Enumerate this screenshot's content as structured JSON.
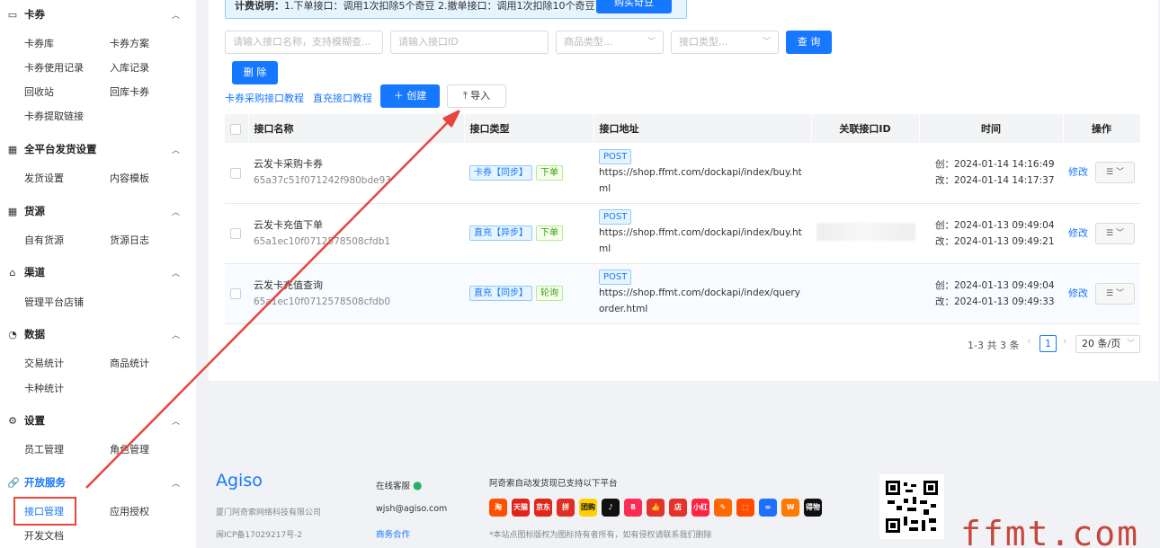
{
  "sidebar": {
    "sections": [
      {
        "title": "卡券",
        "icon": "card-icon",
        "items": [
          "卡券库",
          "卡券方案",
          "卡券使用记录",
          "入库记录",
          "回收站",
          "回库卡券",
          "卡券提取链接"
        ]
      },
      {
        "title": "全平台发货设置",
        "icon": "grid-icon",
        "items": [
          "发货设置",
          "内容模板"
        ]
      },
      {
        "title": "货源",
        "icon": "grid-icon",
        "items": [
          "自有货源",
          "货源日志"
        ]
      },
      {
        "title": "渠道",
        "icon": "store-icon",
        "items": [
          "管理平台店铺"
        ]
      },
      {
        "title": "数据",
        "icon": "pie-icon",
        "items": [
          "交易统计",
          "商品统计",
          "卡种统计"
        ]
      },
      {
        "title": "设置",
        "icon": "gear-icon",
        "items": [
          "员工管理",
          "角色管理"
        ]
      },
      {
        "title": "开放服务",
        "icon": "link-icon",
        "items": [
          "接口管理",
          "应用授权",
          "开发文档"
        ]
      }
    ]
  },
  "notice": {
    "label": "计费说明：",
    "text": "1.下单接口：调用1次扣除5个奇豆  2.撤单接口：调用1次扣除10个奇豆",
    "button": "购买奇豆"
  },
  "filters": {
    "name_placeholder": "请输入接口名称，支持模糊查...",
    "id_placeholder": "请输入接口ID",
    "goods_type": "商品类型...",
    "api_type": "接口类型...",
    "query": "查 询",
    "delete": "删 除"
  },
  "toolbar": {
    "tutorial1": "卡券采购接口教程",
    "tutorial2": "直充接口教程",
    "create": "创建",
    "import": "导入"
  },
  "table": {
    "headers": [
      "接口名称",
      "接口类型",
      "接口地址",
      "关联接口ID",
      "时间",
      "操作"
    ],
    "rows": [
      {
        "name": "云发卡采购卡券",
        "id": "65a37c51f071242f980bde93",
        "type_tag": "卡券【同步】",
        "type_tag2": "下单",
        "method": "POST",
        "url": "https://shop.ffmt.com/dockapi/index/buy.html",
        "created": "创：2024-01-14 14:16:49",
        "modified": "改：2024-01-14 14:17:37",
        "edit": "修改"
      },
      {
        "name": "云发卡充值下单",
        "id": "65a1ec10f0712578508cfdb1",
        "type_tag": "直充【异步】",
        "type_tag2": "下单",
        "method": "POST",
        "url": "https://shop.ffmt.com/dockapi/index/buy.html",
        "created": "创：2024-01-13 09:49:04",
        "modified": "改：2024-01-13 09:49:21",
        "edit": "修改"
      },
      {
        "name": "云发卡充值查询",
        "id": "65a1ec10f0712578508cfdb0",
        "type_tag": "直充【同步】",
        "type_tag2": "轮询",
        "method": "POST",
        "url": "https://shop.ffmt.com/dockapi/index/queryorder.html",
        "created": "创：2024-01-13 09:49:04",
        "modified": "改：2024-01-13 09:49:33",
        "edit": "修改"
      }
    ]
  },
  "pagination": {
    "total": "1-3 共 3 条",
    "page": "1",
    "page_size": "20 条/页"
  },
  "footer": {
    "brand": "Agiso",
    "company": "厦门阿奇索网络科技有限公司",
    "icp": "闽ICP备17029217号-2",
    "online_service": "在线客服",
    "email": "wjsh@agiso.com",
    "business": "商务合作",
    "platforms_title": "阿奇索自动发货现已支持以下平台",
    "platforms": [
      {
        "label": "淘",
        "color": "#ff5000"
      },
      {
        "label": "天猫",
        "color": "#e2231a"
      },
      {
        "label": "京东",
        "color": "#e1251b"
      },
      {
        "label": "拼",
        "color": "#e02e24"
      },
      {
        "label": "团购",
        "color": "#ffd100"
      },
      {
        "label": "♪",
        "color": "#111111"
      },
      {
        "label": "8",
        "color": "#fe2c55"
      },
      {
        "label": "👍",
        "color": "#e5332b"
      },
      {
        "label": "店",
        "color": "#e5332b"
      },
      {
        "label": "小红书",
        "color": "#ff2442"
      },
      {
        "label": "✎",
        "color": "#ff6a00"
      },
      {
        "label": "⬚",
        "color": "#ff4d00"
      },
      {
        "label": "∞",
        "color": "#1e6fff"
      },
      {
        "label": "W",
        "color": "#ff7a00"
      },
      {
        "label": "得物",
        "color": "#111111"
      }
    ],
    "copyright": "*本站点图标版权为图标持有者所有，如有侵权请联系我们删除"
  },
  "watermark": "ffmt.com",
  "colors": {
    "primary": "#1677ff",
    "annotation": "#e8453c"
  }
}
